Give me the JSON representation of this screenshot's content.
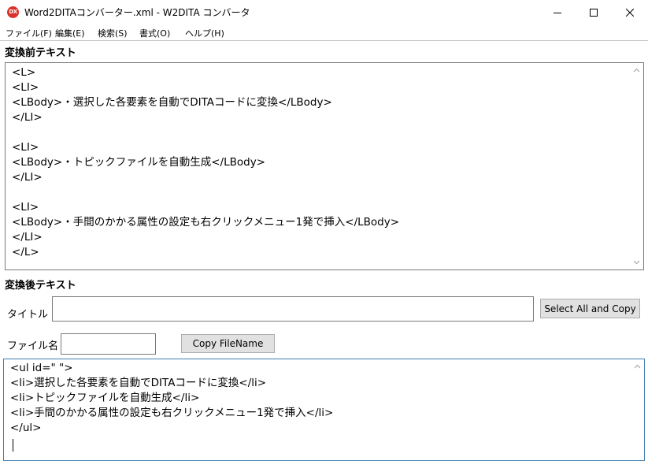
{
  "window": {
    "icon_text": "DX",
    "title": "Word2DITAコンバーター.xml - W2DITA コンバータ"
  },
  "menu": [
    "ファイル(F)",
    "編集(E)",
    "検索(S)",
    "書式(O)",
    "ヘルプ(H)"
  ],
  "before_section": {
    "label": "変換前テキスト",
    "lines": [
      "<L>",
      "<LI>",
      "<LBody>・選択した各要素を自動でDITAコードに変換</LBody>",
      "</LI>",
      "",
      "<LI>",
      "<LBody>・トピックファイルを自動生成</LBody>",
      "</LI>",
      "",
      "<LI>",
      "<LBody>・手間のかかる属性の設定も右クリックメニュー1発で挿入</LBody>",
      "</LI>",
      "</L>"
    ]
  },
  "after_section": {
    "label": "変換後テキスト",
    "title_label": "タイトル",
    "title_value": "",
    "select_all_copy_button": "Select All and Copy",
    "filename_label": "ファイル名",
    "filename_value": "",
    "copy_filename_button": "Copy FileName",
    "lines": [
      "<ul id=\" \">",
      "<li>選択した各要素を自動でDITAコードに変換</li>",
      "<li>トピックファイルを自動生成</li>",
      "<li>手間のかかる属性の設定も右クリックメニュー1発で挿入</li>",
      "</ul>"
    ]
  }
}
